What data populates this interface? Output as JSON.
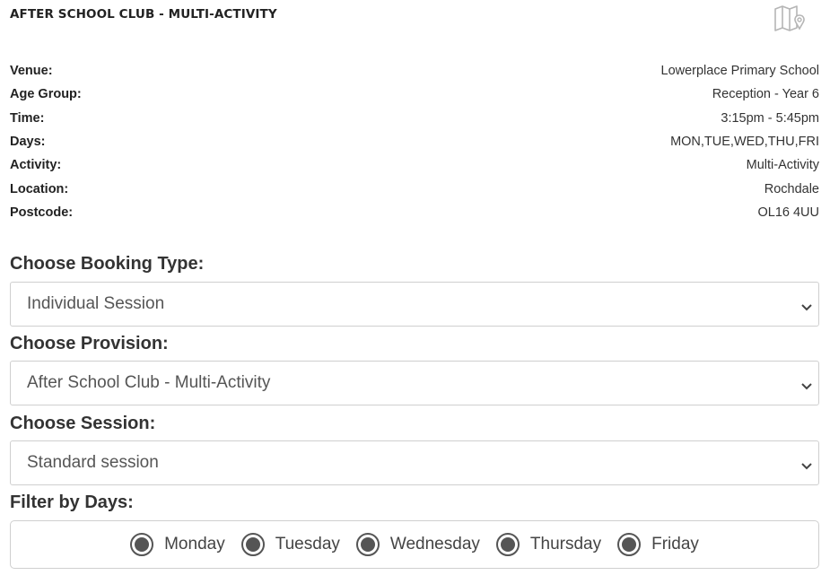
{
  "header": {
    "title": "AFTER SCHOOL CLUB - MULTI-ACTIVITY",
    "map_icon": "map-pin-icon"
  },
  "details": [
    {
      "label": "Venue:",
      "value": "Lowerplace Primary School"
    },
    {
      "label": "Age Group:",
      "value": "Reception - Year 6"
    },
    {
      "label": "Time:",
      "value": "3:15pm - 5:45pm"
    },
    {
      "label": "Days:",
      "value": "MON,TUE,WED,THU,FRI"
    },
    {
      "label": "Activity:",
      "value": "Multi-Activity"
    },
    {
      "label": "Location:",
      "value": "Rochdale"
    },
    {
      "label": "Postcode:",
      "value": "OL16 4UU"
    }
  ],
  "booking_type": {
    "label": "Choose Booking Type:",
    "value": "Individual Session"
  },
  "provision": {
    "label": "Choose Provision:",
    "value": "After School Club - Multi-Activity"
  },
  "session": {
    "label": "Choose Session:",
    "value": "Standard session"
  },
  "filter_days": {
    "label": "Filter by Days:",
    "days": [
      {
        "label": "Monday",
        "checked": true
      },
      {
        "label": "Tuesday",
        "checked": true
      },
      {
        "label": "Wednesday",
        "checked": true
      },
      {
        "label": "Thursday",
        "checked": true
      },
      {
        "label": "Friday",
        "checked": true
      }
    ]
  },
  "colors": {
    "border": "#cfcfcf",
    "radio": "#555555",
    "text": "#333333"
  }
}
